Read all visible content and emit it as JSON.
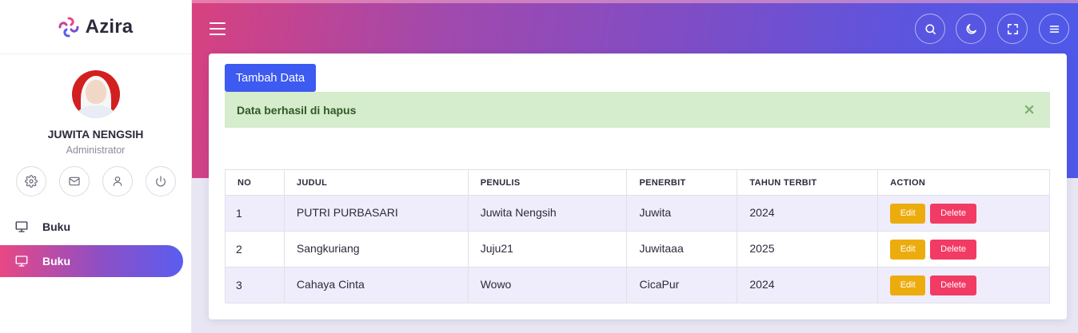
{
  "brand": {
    "name": "Azira"
  },
  "profile": {
    "name": "JUWITA NENGSIH",
    "role": "Administrator"
  },
  "quick_actions": [
    {
      "icon": "gear-icon"
    },
    {
      "icon": "mail-icon"
    },
    {
      "icon": "user-icon"
    },
    {
      "icon": "power-icon"
    }
  ],
  "sidebar": {
    "items": [
      {
        "label": "Buku",
        "icon": "monitor-icon",
        "active": false
      },
      {
        "label": "Buku",
        "icon": "monitor-icon",
        "active": true
      }
    ]
  },
  "header": {
    "buttons": [
      "search-icon",
      "moon-icon",
      "fullscreen-icon",
      "menu-icon"
    ]
  },
  "main": {
    "add_button": "Tambah Data",
    "alert": {
      "message": "Data berhasil di hapus",
      "close": "×"
    },
    "table": {
      "headers": [
        "NO",
        "JUDUL",
        "PENULIS",
        "PENERBIT",
        "TAHUN TERBIT",
        "ACTION"
      ],
      "rows": [
        {
          "no": "1",
          "judul": "PUTRI PURBASARI",
          "penulis": "Juwita Nengsih",
          "penerbit": "Juwita",
          "tahun": "2024"
        },
        {
          "no": "2",
          "judul": "Sangkuriang",
          "penulis": "Juju21",
          "penerbit": "Juwitaaa",
          "tahun": "2025"
        },
        {
          "no": "3",
          "judul": "Cahaya Cinta",
          "penulis": "Wowo",
          "penerbit": "CicaPur",
          "tahun": "2024"
        }
      ],
      "edit_label": "Edit",
      "delete_label": "Delete"
    }
  },
  "colors": {
    "primary": "#3d5af1",
    "edit": "#edac0d",
    "delete": "#f23b64",
    "alert_bg": "#d5eccd",
    "gradient_start": "#e84884",
    "gradient_end": "#4d59ea"
  }
}
